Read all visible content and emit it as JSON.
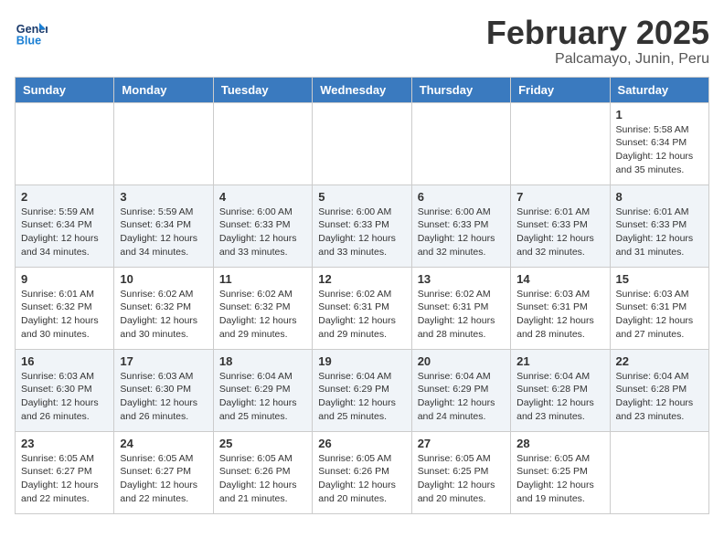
{
  "header": {
    "logo_line1": "General",
    "logo_line2": "Blue",
    "month": "February 2025",
    "location": "Palcamayo, Junin, Peru"
  },
  "weekdays": [
    "Sunday",
    "Monday",
    "Tuesday",
    "Wednesday",
    "Thursday",
    "Friday",
    "Saturday"
  ],
  "weeks": [
    [
      {
        "day": "",
        "info": ""
      },
      {
        "day": "",
        "info": ""
      },
      {
        "day": "",
        "info": ""
      },
      {
        "day": "",
        "info": ""
      },
      {
        "day": "",
        "info": ""
      },
      {
        "day": "",
        "info": ""
      },
      {
        "day": "1",
        "info": "Sunrise: 5:58 AM\nSunset: 6:34 PM\nDaylight: 12 hours\nand 35 minutes."
      }
    ],
    [
      {
        "day": "2",
        "info": "Sunrise: 5:59 AM\nSunset: 6:34 PM\nDaylight: 12 hours\nand 34 minutes."
      },
      {
        "day": "3",
        "info": "Sunrise: 5:59 AM\nSunset: 6:34 PM\nDaylight: 12 hours\nand 34 minutes."
      },
      {
        "day": "4",
        "info": "Sunrise: 6:00 AM\nSunset: 6:33 PM\nDaylight: 12 hours\nand 33 minutes."
      },
      {
        "day": "5",
        "info": "Sunrise: 6:00 AM\nSunset: 6:33 PM\nDaylight: 12 hours\nand 33 minutes."
      },
      {
        "day": "6",
        "info": "Sunrise: 6:00 AM\nSunset: 6:33 PM\nDaylight: 12 hours\nand 32 minutes."
      },
      {
        "day": "7",
        "info": "Sunrise: 6:01 AM\nSunset: 6:33 PM\nDaylight: 12 hours\nand 32 minutes."
      },
      {
        "day": "8",
        "info": "Sunrise: 6:01 AM\nSunset: 6:33 PM\nDaylight: 12 hours\nand 31 minutes."
      }
    ],
    [
      {
        "day": "9",
        "info": "Sunrise: 6:01 AM\nSunset: 6:32 PM\nDaylight: 12 hours\nand 30 minutes."
      },
      {
        "day": "10",
        "info": "Sunrise: 6:02 AM\nSunset: 6:32 PM\nDaylight: 12 hours\nand 30 minutes."
      },
      {
        "day": "11",
        "info": "Sunrise: 6:02 AM\nSunset: 6:32 PM\nDaylight: 12 hours\nand 29 minutes."
      },
      {
        "day": "12",
        "info": "Sunrise: 6:02 AM\nSunset: 6:31 PM\nDaylight: 12 hours\nand 29 minutes."
      },
      {
        "day": "13",
        "info": "Sunrise: 6:02 AM\nSunset: 6:31 PM\nDaylight: 12 hours\nand 28 minutes."
      },
      {
        "day": "14",
        "info": "Sunrise: 6:03 AM\nSunset: 6:31 PM\nDaylight: 12 hours\nand 28 minutes."
      },
      {
        "day": "15",
        "info": "Sunrise: 6:03 AM\nSunset: 6:31 PM\nDaylight: 12 hours\nand 27 minutes."
      }
    ],
    [
      {
        "day": "16",
        "info": "Sunrise: 6:03 AM\nSunset: 6:30 PM\nDaylight: 12 hours\nand 26 minutes."
      },
      {
        "day": "17",
        "info": "Sunrise: 6:03 AM\nSunset: 6:30 PM\nDaylight: 12 hours\nand 26 minutes."
      },
      {
        "day": "18",
        "info": "Sunrise: 6:04 AM\nSunset: 6:29 PM\nDaylight: 12 hours\nand 25 minutes."
      },
      {
        "day": "19",
        "info": "Sunrise: 6:04 AM\nSunset: 6:29 PM\nDaylight: 12 hours\nand 25 minutes."
      },
      {
        "day": "20",
        "info": "Sunrise: 6:04 AM\nSunset: 6:29 PM\nDaylight: 12 hours\nand 24 minutes."
      },
      {
        "day": "21",
        "info": "Sunrise: 6:04 AM\nSunset: 6:28 PM\nDaylight: 12 hours\nand 23 minutes."
      },
      {
        "day": "22",
        "info": "Sunrise: 6:04 AM\nSunset: 6:28 PM\nDaylight: 12 hours\nand 23 minutes."
      }
    ],
    [
      {
        "day": "23",
        "info": "Sunrise: 6:05 AM\nSunset: 6:27 PM\nDaylight: 12 hours\nand 22 minutes."
      },
      {
        "day": "24",
        "info": "Sunrise: 6:05 AM\nSunset: 6:27 PM\nDaylight: 12 hours\nand 22 minutes."
      },
      {
        "day": "25",
        "info": "Sunrise: 6:05 AM\nSunset: 6:26 PM\nDaylight: 12 hours\nand 21 minutes."
      },
      {
        "day": "26",
        "info": "Sunrise: 6:05 AM\nSunset: 6:26 PM\nDaylight: 12 hours\nand 20 minutes."
      },
      {
        "day": "27",
        "info": "Sunrise: 6:05 AM\nSunset: 6:25 PM\nDaylight: 12 hours\nand 20 minutes."
      },
      {
        "day": "28",
        "info": "Sunrise: 6:05 AM\nSunset: 6:25 PM\nDaylight: 12 hours\nand 19 minutes."
      },
      {
        "day": "",
        "info": ""
      }
    ]
  ]
}
